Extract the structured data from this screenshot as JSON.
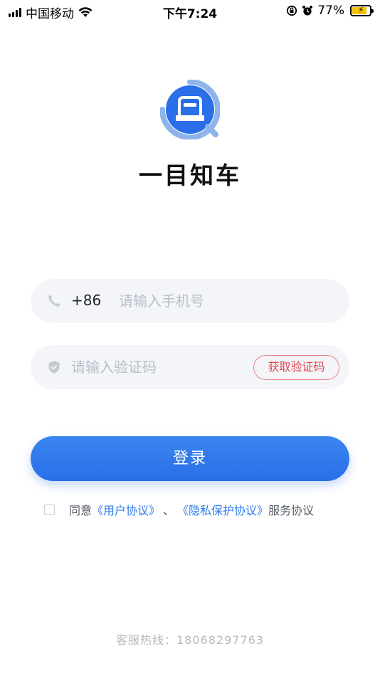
{
  "status_bar": {
    "carrier": "中国移动",
    "time": "下午7:24",
    "battery_percent": "77%",
    "battery_level": 0.77,
    "icons": [
      "signal-icon",
      "wifi-icon",
      "rotation-lock-icon",
      "alarm-icon",
      "battery-charging-icon"
    ]
  },
  "app": {
    "name": "一目知车",
    "logo_icon": "car-magnifier-logo-icon",
    "brand_color": "#2a6ee8"
  },
  "login_form": {
    "phone_prefix": "+86",
    "phone_placeholder": "请输入手机号",
    "phone_value": "",
    "phone_icon": "phone-icon",
    "code_placeholder": "请输入验证码",
    "code_value": "",
    "code_icon": "shield-icon",
    "get_code_label": "获取验证码",
    "login_label": "登录"
  },
  "agreement": {
    "checked": false,
    "prefix": "同意",
    "user_agreement": "《用户协议》",
    "separator": "、",
    "privacy_agreement": "《隐私保护协议》",
    "suffix": "服务协议"
  },
  "footer": {
    "hotline": "客服热线：18068297763"
  }
}
